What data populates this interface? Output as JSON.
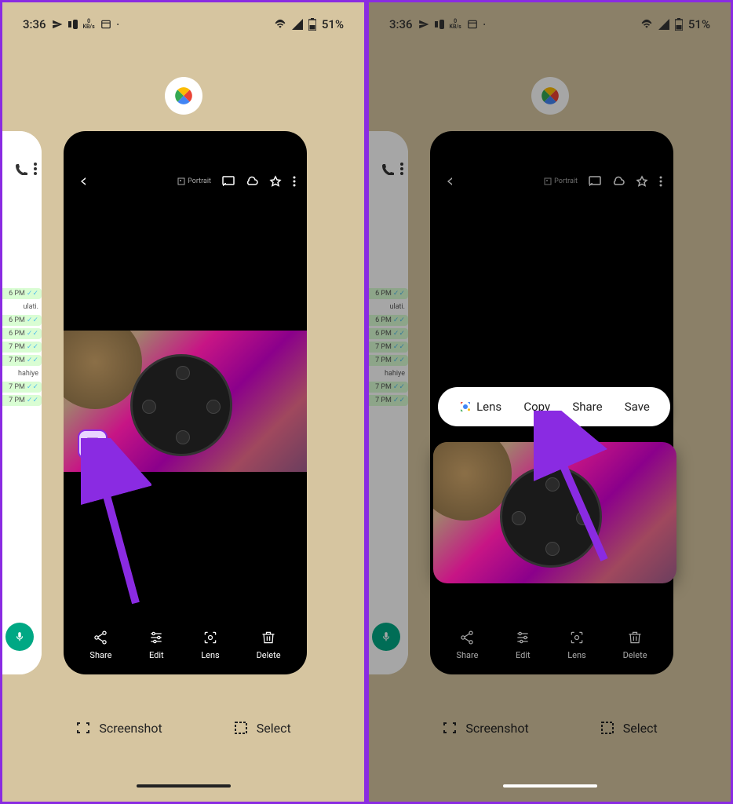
{
  "status": {
    "time": "3:36",
    "kbs": "0",
    "kbs_unit": "KB/s",
    "battery": "51%"
  },
  "photo_header": {
    "portrait": "Portrait"
  },
  "actions": {
    "share": "Share",
    "edit": "Edit",
    "lens": "Lens",
    "delete": "Delete"
  },
  "recent": {
    "screenshot": "Screenshot",
    "select": "Select"
  },
  "popup": {
    "lens": "Lens",
    "copy": "Copy",
    "share": "Share",
    "save": "Save"
  },
  "chat": {
    "name": "ulati.",
    "text1": "hahiye",
    "times": [
      "6 PM",
      "6 PM",
      "6 PM",
      "7 PM",
      "7 PM",
      "7 PM",
      "7 PM"
    ]
  }
}
